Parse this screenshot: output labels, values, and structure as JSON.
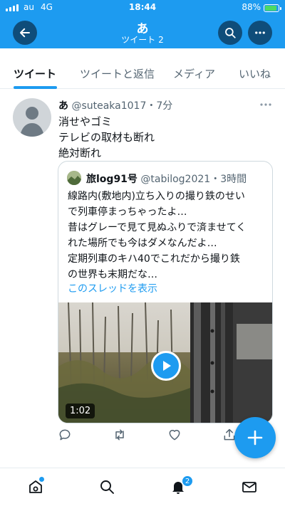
{
  "status_bar": {
    "carrier": "au",
    "network": "4G",
    "time": "18:44",
    "battery_text": "88%",
    "battery_level": 0.88,
    "battery_color": "#4cd964"
  },
  "header": {
    "title": "あ",
    "subtitle": "ツイート 2",
    "back_icon": "arrow-left-icon",
    "search_icon": "search-icon",
    "more_icon": "more-icon",
    "color": "#1d9bf0"
  },
  "tabs": [
    {
      "label": "ツイート",
      "active": true
    },
    {
      "label": "ツイートと返信",
      "active": false
    },
    {
      "label": "メディア",
      "active": false
    },
    {
      "label": "いいね",
      "active": false
    }
  ],
  "tweet": {
    "name": "あ",
    "handle": "@suteaka1017",
    "time": "・7分",
    "lines": [
      "消せやゴミ",
      "テレビの取材も断れ",
      "絶対断れ"
    ],
    "quoted": {
      "name": "旅log91号",
      "handle": "@tabilog2021",
      "time": "・3時間",
      "lines": [
        "線路内(敷地内)立ち入りの撮り鉄のせい",
        "で列車停まっちゃったよ…",
        "昔はグレーで見て見ぬふりで済ませてく",
        "れた場所でも今はダメなんだよ…",
        "定期列車のキハ40でこれだから撮り鉄",
        "の世界も末期だな…"
      ],
      "thread_link": "このスレッドを表示",
      "video_duration": "1:02"
    },
    "actions": [
      "reply-icon",
      "retweet-icon",
      "like-icon",
      "share-icon"
    ]
  },
  "compose_icon": "plus-icon",
  "bottom_nav": {
    "items": [
      "home-icon",
      "search-icon",
      "bell-icon",
      "mail-icon"
    ],
    "notification_count": "2"
  }
}
